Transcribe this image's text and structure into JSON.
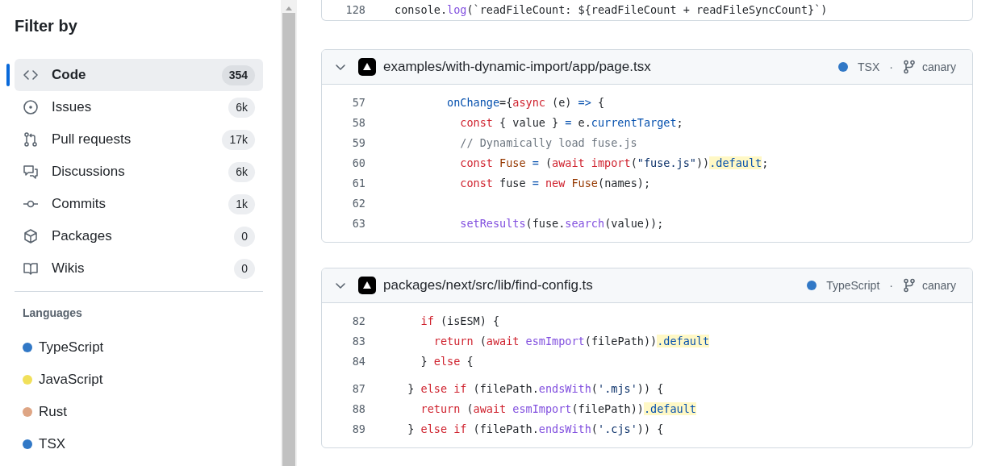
{
  "sidebar": {
    "title": "Filter by",
    "items": [
      {
        "kind": "code",
        "label": "Code",
        "count": "354",
        "selected": true
      },
      {
        "kind": "issue",
        "label": "Issues",
        "count": "6k",
        "selected": false
      },
      {
        "kind": "pull",
        "label": "Pull requests",
        "count": "17k",
        "selected": false
      },
      {
        "kind": "discussion",
        "label": "Discussions",
        "count": "6k",
        "selected": false
      },
      {
        "kind": "commit",
        "label": "Commits",
        "count": "1k",
        "selected": false
      },
      {
        "kind": "package",
        "label": "Packages",
        "count": "0",
        "selected": false
      },
      {
        "kind": "wiki",
        "label": "Wikis",
        "count": "0",
        "selected": false
      }
    ],
    "languages_title": "Languages",
    "languages": [
      {
        "name": "TypeScript",
        "color": "#3178c6"
      },
      {
        "name": "JavaScript",
        "color": "#f1e05a"
      },
      {
        "name": "Rust",
        "color": "#dea584"
      },
      {
        "name": "TSX",
        "color": "#3178c6"
      }
    ]
  },
  "results": [
    {
      "lines": [
        {
          "number": "128",
          "tokens": [
            {
              "kind": "plain",
              "t": "console."
            },
            {
              "kind": "fn",
              "t": "log"
            },
            {
              "kind": "plain",
              "t": "(`readFileCount: ${readFileCount + readFileSyncCount}`)"
            }
          ]
        }
      ]
    },
    {
      "path": "examples/with-dynamic-import/app/page.tsx",
      "language": "TSX",
      "color": "#3178c6",
      "separator": "·",
      "branch": "canary",
      "lines": [
        {
          "number": "57",
          "tokens": [
            {
              "kind": "prop",
              "t": "        onChange"
            },
            {
              "kind": "plain",
              "t": "={"
            },
            {
              "kind": "kw",
              "t": "async"
            },
            {
              "kind": "plain",
              "t": " (e) "
            },
            {
              "kind": "prop",
              "t": "=>"
            },
            {
              "kind": "plain",
              "t": " {"
            }
          ]
        },
        {
          "number": "58",
          "tokens": [
            {
              "kind": "kw",
              "t": "          const"
            },
            {
              "kind": "plain",
              "t": " { value } "
            },
            {
              "kind": "prop",
              "t": "="
            },
            {
              "kind": "plain",
              "t": " e."
            },
            {
              "kind": "prop",
              "t": "currentTarget"
            },
            {
              "kind": "plain",
              "t": ";"
            }
          ]
        },
        {
          "number": "59",
          "tokens": [
            {
              "kind": "com",
              "t": "          // Dynamically load fuse.js"
            }
          ]
        },
        {
          "number": "60",
          "tokens": [
            {
              "kind": "kw",
              "t": "          const "
            },
            {
              "kind": "ent",
              "t": "Fuse "
            },
            {
              "kind": "prop",
              "t": "="
            },
            {
              "kind": "plain",
              "t": " ("
            },
            {
              "kind": "kw",
              "t": "await import"
            },
            {
              "kind": "plain",
              "t": "("
            },
            {
              "kind": "str",
              "t": "\"fuse.js\""
            },
            {
              "kind": "plain",
              "t": "))"
            },
            {
              "kind": "match",
              "t": ".default"
            },
            {
              "kind": "plain",
              "t": ";"
            }
          ]
        },
        {
          "number": "61",
          "tokens": [
            {
              "kind": "kw",
              "t": "          const"
            },
            {
              "kind": "plain",
              "t": " fuse "
            },
            {
              "kind": "prop",
              "t": "="
            },
            {
              "kind": "kw",
              "t": " new "
            },
            {
              "kind": "ent",
              "t": "Fuse"
            },
            {
              "kind": "plain",
              "t": "(names);"
            }
          ]
        },
        {
          "number": "62"
        },
        {
          "number": "63",
          "tokens": [
            {
              "kind": "fn",
              "t": "          setResults"
            },
            {
              "kind": "plain",
              "t": "(fuse."
            },
            {
              "kind": "fn",
              "t": "search"
            },
            {
              "kind": "plain",
              "t": "(value));"
            }
          ]
        }
      ]
    },
    {
      "path": "packages/next/src/lib/find-config.ts",
      "language": "TypeScript",
      "color": "#3178c6",
      "separator": "·",
      "branch": "canary",
      "lines": [
        {
          "number": "82",
          "tokens": [
            {
              "kind": "kw",
              "t": "    if"
            },
            {
              "kind": "plain",
              "t": " (isESM) {"
            }
          ]
        },
        {
          "number": "83",
          "tokens": [
            {
              "kind": "kw",
              "t": "      return"
            },
            {
              "kind": "plain",
              "t": " ("
            },
            {
              "kind": "kw",
              "t": "await "
            },
            {
              "kind": "fn",
              "t": "esmImport"
            },
            {
              "kind": "plain",
              "t": "(filePath))"
            },
            {
              "kind": "match",
              "t": ".default"
            }
          ]
        },
        {
          "number": "84",
          "tokens": [
            {
              "kind": "plain",
              "t": "    } "
            },
            {
              "kind": "kw",
              "t": "else"
            },
            {
              "kind": "plain",
              "t": " {"
            }
          ]
        },
        {
          "number": "87",
          "gap_before": true,
          "tokens": [
            {
              "kind": "plain",
              "t": "  } "
            },
            {
              "kind": "kw",
              "t": "else if"
            },
            {
              "kind": "plain",
              "t": " (filePath."
            },
            {
              "kind": "fn",
              "t": "endsWith"
            },
            {
              "kind": "plain",
              "t": "("
            },
            {
              "kind": "str",
              "t": "'.mjs'"
            },
            {
              "kind": "plain",
              "t": ")) {"
            }
          ]
        },
        {
          "number": "88",
          "tokens": [
            {
              "kind": "kw",
              "t": "    return"
            },
            {
              "kind": "plain",
              "t": " ("
            },
            {
              "kind": "kw",
              "t": "await "
            },
            {
              "kind": "fn",
              "t": "esmImport"
            },
            {
              "kind": "plain",
              "t": "(filePath))"
            },
            {
              "kind": "match",
              "t": ".default"
            }
          ]
        },
        {
          "number": "89",
          "tokens": [
            {
              "kind": "plain",
              "t": "  } "
            },
            {
              "kind": "kw",
              "t": "else if"
            },
            {
              "kind": "plain",
              "t": " (filePath."
            },
            {
              "kind": "fn",
              "t": "endsWith"
            },
            {
              "kind": "plain",
              "t": "("
            },
            {
              "kind": "str",
              "t": "'.cjs'"
            },
            {
              "kind": "plain",
              "t": ")) {"
            }
          ]
        }
      ]
    }
  ]
}
